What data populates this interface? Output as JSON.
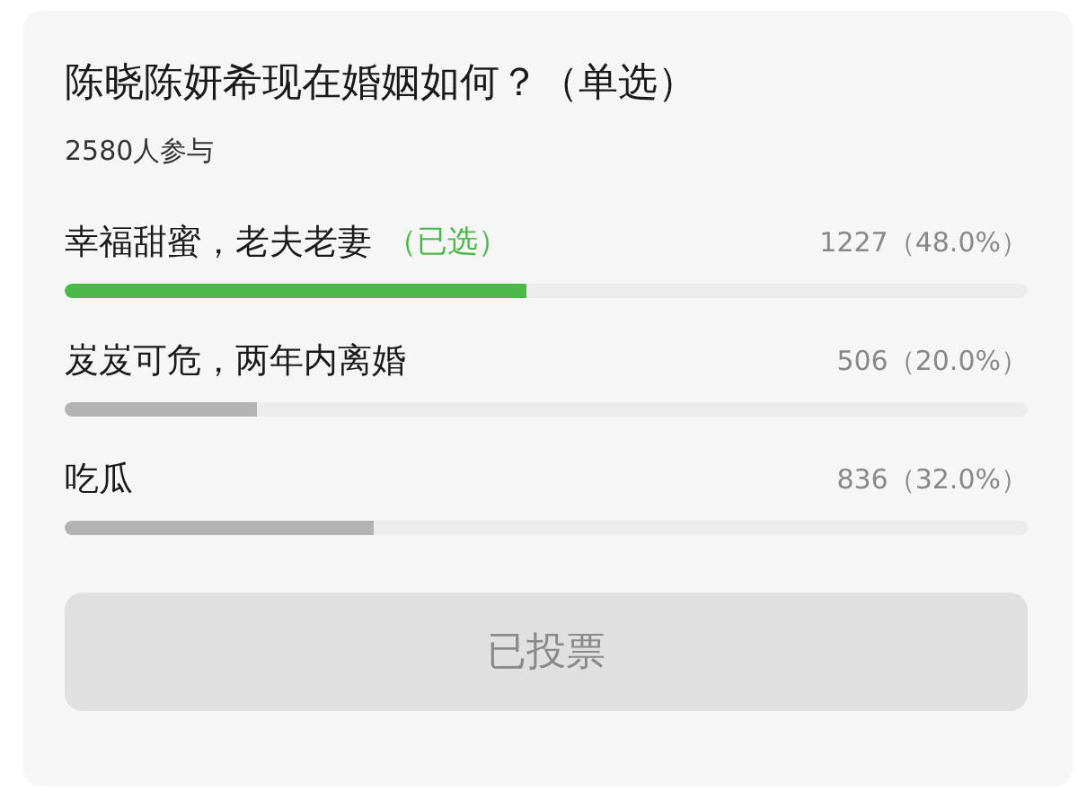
{
  "poll": {
    "title": "陈晓陈妍希现在婚姻如何？（单选）",
    "participants": "2580人参与",
    "options": [
      {
        "label": "幸福甜蜜，老夫老妻",
        "tag": "（已选）",
        "selected": true,
        "count": "1227（48.0%）",
        "level": 0.48
      },
      {
        "label": "岌岌可危，两年内离婚",
        "selected": false,
        "count": "506（20.0%）",
        "level": 0.2
      },
      {
        "label": "吃瓜",
        "selected": false,
        "count": "836（32.0%）",
        "level": 0.32
      }
    ],
    "button": {
      "label": "已投票",
      "disabled": true
    }
  }
}
